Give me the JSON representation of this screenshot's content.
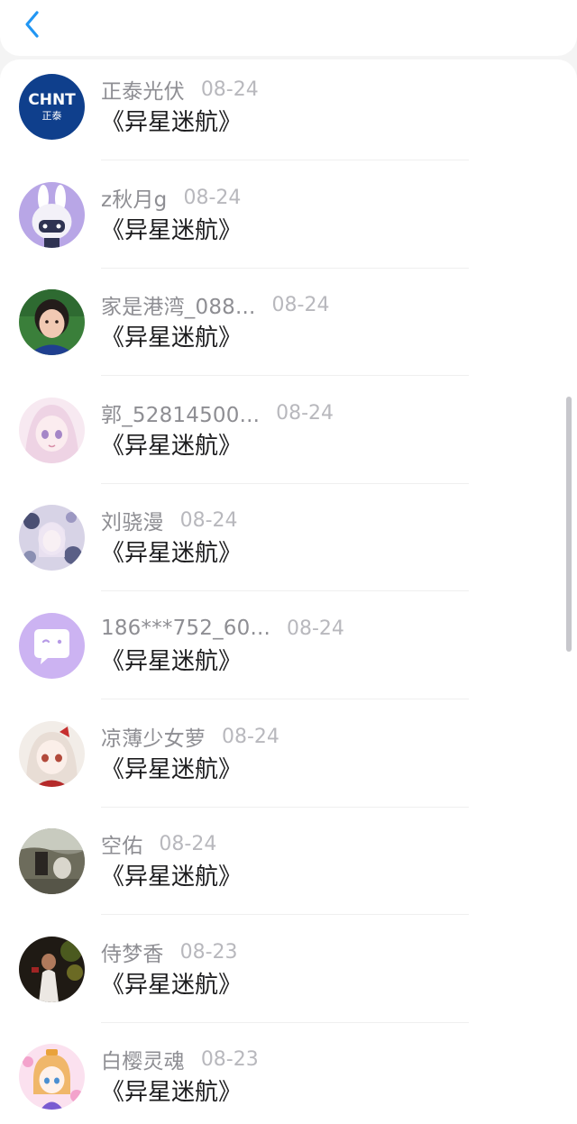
{
  "header": {
    "back_icon": "chevron-left-icon"
  },
  "comments": [
    {
      "name": "正泰光伏",
      "date": "08-24",
      "text": "《异星迷航》",
      "avatar": "chnt-logo"
    },
    {
      "name": "z秋月g",
      "date": "08-24",
      "text": "《异星迷航》",
      "avatar": "cartoon-bunny"
    },
    {
      "name": "家是港湾_088...",
      "date": "08-24",
      "text": "《异星迷航》",
      "avatar": "child-photo"
    },
    {
      "name": "郭_52814500...",
      "date": "08-24",
      "text": "《异星迷航》",
      "avatar": "anime-girl-pink"
    },
    {
      "name": "刘骁漫",
      "date": "08-24",
      "text": "《异星迷航》",
      "avatar": "anime-art-lavender"
    },
    {
      "name": "186***752_60...",
      "date": "08-24",
      "text": "《异星迷航》",
      "avatar": "default-chat-bubble"
    },
    {
      "name": "凉薄少女萝",
      "date": "08-24",
      "text": "《异星迷航》",
      "avatar": "anime-girl-bow"
    },
    {
      "name": "空佑",
      "date": "08-24",
      "text": "《异星迷航》",
      "avatar": "outdoor-photo"
    },
    {
      "name": "侍梦香",
      "date": "08-23",
      "text": "《异星迷航》",
      "avatar": "dark-portrait"
    },
    {
      "name": "白樱灵魂",
      "date": "08-23",
      "text": "《异星迷航》",
      "avatar": "chibi-girl"
    }
  ],
  "avatar_logo_text": {
    "line1": "CHNT",
    "line2": "正泰"
  },
  "colors": {
    "name": "#8e8e93",
    "date": "#b8b8bd",
    "text": "#1c1c1e",
    "accent": "#2196f3",
    "chnt_blue": "#0f3f8c",
    "default_avatar": "#ccb3f2"
  }
}
